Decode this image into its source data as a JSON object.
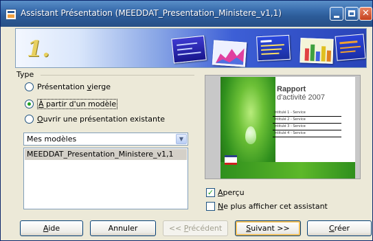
{
  "window": {
    "title": "Assistant Présentation (MEEDDAT_Presentation_Ministere_v1,1)",
    "accent_color": "#2c5b98"
  },
  "banner": {
    "step": "1."
  },
  "type_group": {
    "label": "Type",
    "options": [
      {
        "pre": "Présentation ",
        "accel": "v",
        "post": "ierge",
        "selected": false
      },
      {
        "pre": "",
        "accel": "À",
        "post": " partir d'un modèle",
        "selected": true
      },
      {
        "pre": "",
        "accel": "O",
        "post": "uvrir une présentation existante",
        "selected": false
      }
    ]
  },
  "template_select": {
    "value": "Mes modèles",
    "icon": "chevron-down-icon"
  },
  "template_list": {
    "items": [
      "MEEDDAT_Presentation_Ministere_v1,1"
    ]
  },
  "preview": {
    "title_line1": "Rapport",
    "title_line2": "d'activité 2007",
    "entries": [
      "Intitulé 1 - Service",
      "Intitulé 2 - Service",
      "Intitulé 3 - Service",
      "Intitulé 4 - Service"
    ]
  },
  "options": {
    "apercu": {
      "accel": "A",
      "rest": "perçu",
      "checked": true
    },
    "no_show": {
      "accel": "N",
      "rest": "e plus afficher cet assistant",
      "checked": false
    }
  },
  "buttons": {
    "help": {
      "accel": "A",
      "rest": "ide"
    },
    "cancel": {
      "label": "Annuler"
    },
    "previous": {
      "pre": "<< ",
      "accel": "P",
      "rest": "récédent"
    },
    "next": {
      "accel": "S",
      "rest": "uivant >>"
    },
    "create": {
      "accel": "C",
      "rest": "réer"
    }
  }
}
